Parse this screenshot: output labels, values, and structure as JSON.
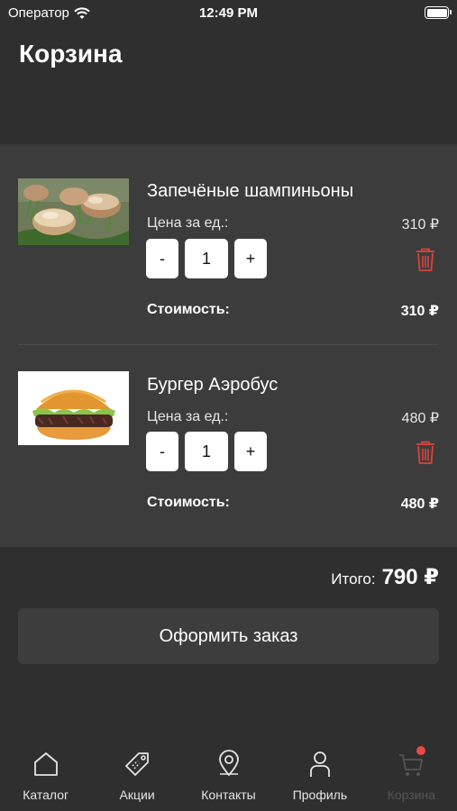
{
  "status_bar": {
    "carrier": "Оператор",
    "time": "12:49 PM"
  },
  "page_title": "Корзина",
  "cart": {
    "price_label": "Цена за ед.:",
    "cost_label": "Стоимость:",
    "items": [
      {
        "name": "Запечёные шампиньоны",
        "unit_price": "310 ₽",
        "quantity": "1",
        "cost": "310 ₽",
        "image": "baked-mushrooms-photo"
      },
      {
        "name": "Бургер Аэробус",
        "unit_price": "480 ₽",
        "quantity": "1",
        "cost": "480 ₽",
        "image": "burger-photo"
      }
    ],
    "decrement": "-",
    "increment": "+"
  },
  "total": {
    "label": "Итого:",
    "value": "790 ₽"
  },
  "checkout_label": "Оформить заказ",
  "tabs": [
    {
      "label": "Каталог",
      "icon": "home-icon"
    },
    {
      "label": "Акции",
      "icon": "tag-icon"
    },
    {
      "label": "Контакты",
      "icon": "location-pin-icon"
    },
    {
      "label": "Профиль",
      "icon": "person-icon"
    },
    {
      "label": "Корзина",
      "icon": "cart-icon",
      "badge": true
    }
  ],
  "colors": {
    "background": "#2f2f2f",
    "panel": "#3c3c3c",
    "trash": "#d9443c",
    "badge": "#e84848"
  }
}
